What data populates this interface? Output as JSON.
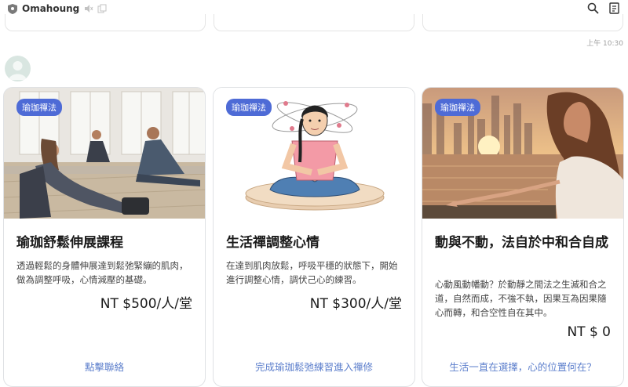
{
  "header": {
    "title": "Omahoung"
  },
  "timestamp": "上午 10:30",
  "cards": [
    {
      "tag": "瑜珈禪法",
      "title": "瑜珈舒鬆伸展課程",
      "description": "透過輕鬆的身體伸展達到鬆弛緊繃的肌肉，做為調整呼吸，心情減壓的基礎。",
      "price": "NT $500/人/堂",
      "link": "點擊聯絡"
    },
    {
      "tag": "瑜珈禪法",
      "title": "生活禪調整心情",
      "description": "在達到肌肉放鬆，呼吸平穩的狀態下，開始進行調整心情，調伏己心的練習。",
      "price": "NT $300/人/堂",
      "link": "完成瑜珈鬆弛練習進入禪修"
    },
    {
      "tag": "瑜珈禪法",
      "title": "動與不動，法自於中和合自成",
      "description": "心動風動幡動？於動靜之間法之生滅和合之道，自然而成，不強不執，因果互為因果隨心而轉，和合空性自在其中。",
      "price": "NT $ 0",
      "link": "生活一直在選擇，心的位置何在？"
    }
  ]
}
